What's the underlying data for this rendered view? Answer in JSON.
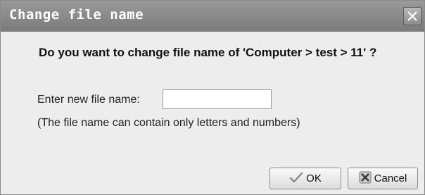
{
  "dialog": {
    "title": "Change file name",
    "close_icon": "close-icon",
    "question": "Do you want to change file name of 'Computer > test > 11' ?",
    "field_label": "Enter new file name:",
    "input_value": "",
    "input_placeholder": "",
    "hint": "(The file name can contain only letters and numbers)",
    "ok_label": "OK",
    "ok_icon": "checkmark-icon",
    "cancel_label": "Cancel",
    "cancel_icon": "cross-icon"
  }
}
